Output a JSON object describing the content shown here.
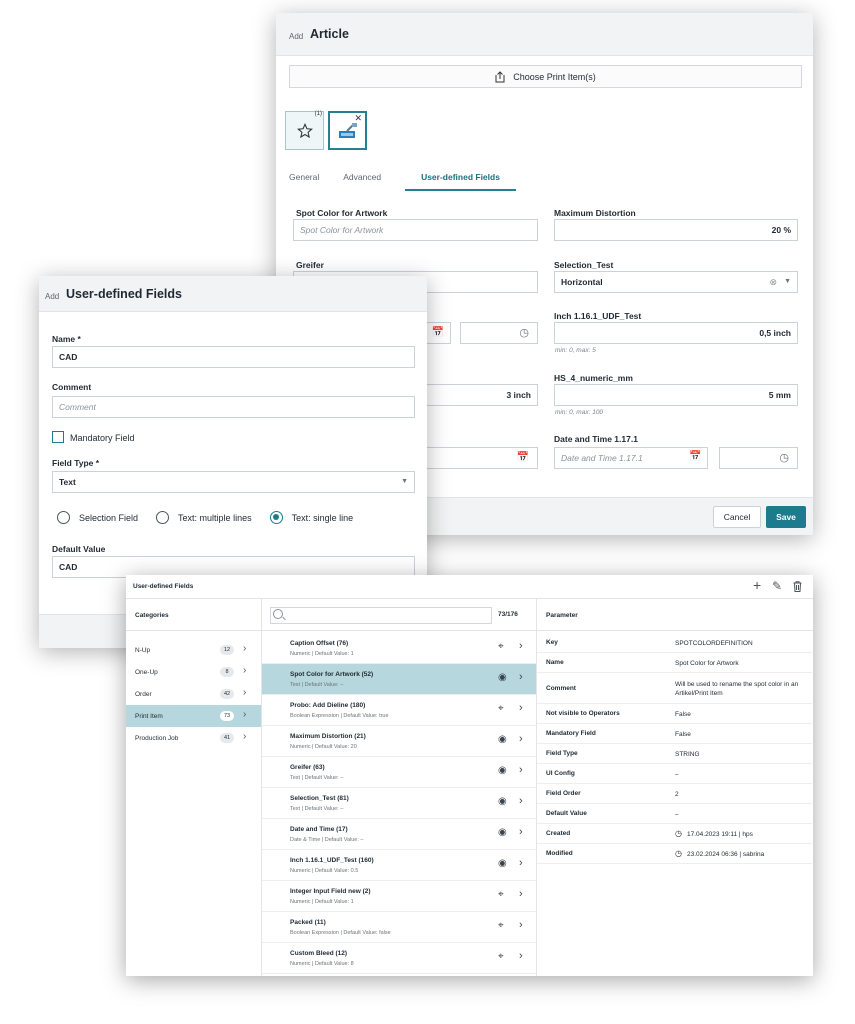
{
  "article": {
    "prefix": "Add",
    "title": "Article",
    "choose_label": "Choose Print Item(s)",
    "thumb_count": "(1)",
    "tabs": [
      "General",
      "Advanced",
      "User-defined Fields"
    ],
    "fields": {
      "spot_color_label": "Spot Color for Artwork",
      "spot_color_placeholder": "Spot Color for Artwork",
      "max_distortion_label": "Maximum Distortion",
      "max_distortion_value": "20",
      "max_distortion_unit": "%",
      "greifer_label": "Greifer",
      "selection_test_label": "Selection_Test",
      "selection_test_value": "Horizontal",
      "inch_label": "Inch 1.16.1_UDF_Test",
      "inch_value": "0,5 inch",
      "inch_hint": "min: 0, max: 5",
      "hs_label": "HS_4_numeric_mm",
      "hs_value": "5 mm",
      "hs_hint": "min: 0, max: 100",
      "hidden_inch_value": "3 inch",
      "datetime_label": "Date and Time 1.17.1",
      "datetime_placeholder": "Date and Time 1.17.1"
    },
    "cancel_label": "Cancel",
    "save_label": "Save"
  },
  "udf_dialog": {
    "prefix": "Add",
    "title": "User-defined Fields",
    "name_label": "Name *",
    "name_value": "CAD",
    "comment_label": "Comment",
    "comment_placeholder": "Comment",
    "mandatory_label": "Mandatory Field",
    "field_type_label": "Field Type *",
    "field_type_value": "Text",
    "radio_options": [
      "Selection Field",
      "Text: multiple lines",
      "Text: single line"
    ],
    "default_value_label": "Default Value",
    "default_value": "CAD"
  },
  "manager": {
    "title": "User-defined Fields",
    "categories_header": "Categories",
    "categories": [
      {
        "name": "N-Up",
        "count": "12"
      },
      {
        "name": "One-Up",
        "count": "8"
      },
      {
        "name": "Order",
        "count": "42"
      },
      {
        "name": "Print Item",
        "count": "73"
      },
      {
        "name": "Production Job",
        "count": "41"
      }
    ],
    "list_count": "73/176",
    "items": [
      {
        "name": "Caption Offset (76)",
        "sub": "Numeric | Default Value: 1",
        "icon": "⌖"
      },
      {
        "name": "Spot Color for Artwork (52)",
        "sub": "Text | Default Value: –",
        "icon": "◉"
      },
      {
        "name": "Probo: Add Dieline (180)",
        "sub": "Boolean Expression | Default Value: true",
        "icon": "⌖"
      },
      {
        "name": "Maximum Distortion (21)",
        "sub": "Numeric | Default Value: 20",
        "icon": "◉"
      },
      {
        "name": "Greifer (63)",
        "sub": "Text | Default Value: –",
        "icon": "◉"
      },
      {
        "name": "Selection_Test (81)",
        "sub": "Text | Default Value: –",
        "icon": "◉"
      },
      {
        "name": "Date and Time (17)",
        "sub": "Date & Time | Default Value: –",
        "icon": "◉"
      },
      {
        "name": "Inch 1.16.1_UDF_Test (160)",
        "sub": "Numeric | Default Value: 0.5",
        "icon": "◉"
      },
      {
        "name": "Integer Input Field new (2)",
        "sub": "Numeric | Default Value: 1",
        "icon": "⌖"
      },
      {
        "name": "Packed (11)",
        "sub": "Boolean Expression | Default Value: false",
        "icon": "⌖"
      },
      {
        "name": "Custom Bleed (12)",
        "sub": "Numeric | Default Value: 8",
        "icon": "⌖"
      }
    ],
    "parameter_header": "Parameter",
    "params": [
      {
        "key": "Key",
        "value": "SPOTCOLORDEFINITION"
      },
      {
        "key": "Name",
        "value": "Spot Color for Artwork"
      },
      {
        "key": "Comment",
        "value": "Will be used to rename the spot color in an Artikel/Print Item"
      },
      {
        "key": "Not visible to Operators",
        "value": "False"
      },
      {
        "key": "Mandatory Field",
        "value": "False"
      },
      {
        "key": "Field Type",
        "value": "STRING"
      },
      {
        "key": "UI Config",
        "value": "–"
      },
      {
        "key": "Field Order",
        "value": "2"
      },
      {
        "key": "Default Value",
        "value": "–"
      },
      {
        "key": "Created",
        "value": "17.04.2023 19:11  |  hps"
      },
      {
        "key": "Modified",
        "value": "23.02.2024 06:36  |  sabrina"
      }
    ]
  }
}
